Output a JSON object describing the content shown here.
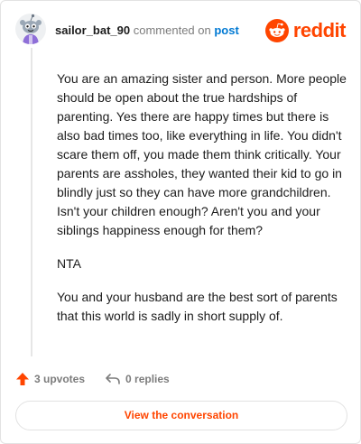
{
  "header": {
    "author": "sailor_bat_90",
    "action": "commented on",
    "post_link": "post",
    "brand": "reddit",
    "avatar_icon": "snoo-avatar-icon",
    "brand_icon": "reddit-logo-icon"
  },
  "comment": {
    "paragraphs": [
      "You are an amazing sister and person. More people should be open about the true hardships of parenting. Yes there are happy times but there is also bad times too, like everything in life. You didn't scare them off, you made them think critically. Your parents are assholes, they wanted their kid to go in blindly just so they can have more grandchildren. Isn't your children enough? Aren't you and your siblings happiness enough for them?",
      "NTA",
      "You and your husband are the best sort of parents that this world is sadly in short supply of."
    ]
  },
  "footer": {
    "upvotes": "3 upvotes",
    "replies": "0 replies",
    "view_button": "View the conversation",
    "upvote_icon": "upvote-arrow-icon",
    "reply_icon": "reply-arrow-icon"
  },
  "colors": {
    "brand": "#ff4500",
    "link": "#0079d3",
    "muted": "#7c7c7c"
  }
}
